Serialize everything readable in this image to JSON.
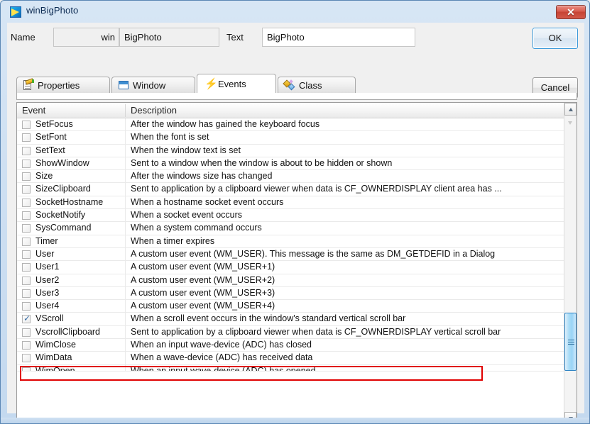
{
  "window": {
    "title": "winBigPhoto",
    "title_icon": "app-photo-icon",
    "close_label": "✕"
  },
  "fields": {
    "name_label": "Name",
    "name_prefix": "win",
    "name_value": "BigPhoto",
    "text_label": "Text",
    "text_value": "BigPhoto"
  },
  "buttons": {
    "ok": "OK",
    "cancel": "Cancel"
  },
  "tabs": [
    {
      "label": "Properties",
      "icon": "properties-icon",
      "active": false
    },
    {
      "label": "Window",
      "icon": "window-icon",
      "active": false
    },
    {
      "label": "Events",
      "icon": "lightning-bolt-icon",
      "active": true
    },
    {
      "label": "Class",
      "icon": "class-diamond-icon",
      "active": false
    }
  ],
  "list": {
    "columns": [
      "Event",
      "Description"
    ],
    "rows": [
      {
        "checked": false,
        "event": "SetFocus",
        "description": "After the window has gained the keyboard focus"
      },
      {
        "checked": false,
        "event": "SetFont",
        "description": "When the font is set"
      },
      {
        "checked": false,
        "event": "SetText",
        "description": "When the window text is set"
      },
      {
        "checked": false,
        "event": "ShowWindow",
        "description": "Sent to a window when the window is about to be hidden or shown"
      },
      {
        "checked": false,
        "event": "Size",
        "description": "After the windows size has changed"
      },
      {
        "checked": false,
        "event": "SizeClipboard",
        "description": "Sent to application by a clipboard viewer when data is CF_OWNERDISPLAY client area has ..."
      },
      {
        "checked": false,
        "event": "SocketHostname",
        "description": "When a hostname socket event occurs"
      },
      {
        "checked": false,
        "event": "SocketNotify",
        "description": "When a socket event occurs"
      },
      {
        "checked": false,
        "event": "SysCommand",
        "description": "When a system command occurs"
      },
      {
        "checked": false,
        "event": "Timer",
        "description": "When a timer expires"
      },
      {
        "checked": false,
        "event": "User",
        "description": "A custom user event (WM_USER).  This message is the same as DM_GETDEFID in a Dialog"
      },
      {
        "checked": false,
        "event": "User1",
        "description": "A custom user event (WM_USER+1)"
      },
      {
        "checked": false,
        "event": "User2",
        "description": "A custom user event (WM_USER+2)"
      },
      {
        "checked": false,
        "event": "User3",
        "description": "A custom user event (WM_USER+3)"
      },
      {
        "checked": false,
        "event": "User4",
        "description": "A custom user event (WM_USER+4)"
      },
      {
        "checked": true,
        "event": "VScroll",
        "description": "When a scroll event occurs in the window's standard vertical scroll bar"
      },
      {
        "checked": false,
        "event": "VscrollClipboard",
        "description": "Sent to application by a clipboard viewer when data is CF_OWNERDISPLAY vertical scroll bar"
      },
      {
        "checked": false,
        "event": "WimClose",
        "description": "When an input wave-device (ADC) has closed"
      },
      {
        "checked": false,
        "event": "WimData",
        "description": "When a wave-device (ADC) has received data"
      },
      {
        "checked": false,
        "event": "WimOpen",
        "description": "When an input wave-device (ADC) has opened"
      }
    ]
  },
  "scrollbar": {
    "up_arrow": "scroll-up-arrow",
    "down_arrow": "scroll-down-arrow",
    "thumb": "scroll-thumb"
  },
  "annotation": {
    "target_row": "VScroll",
    "color": "#e00000"
  }
}
